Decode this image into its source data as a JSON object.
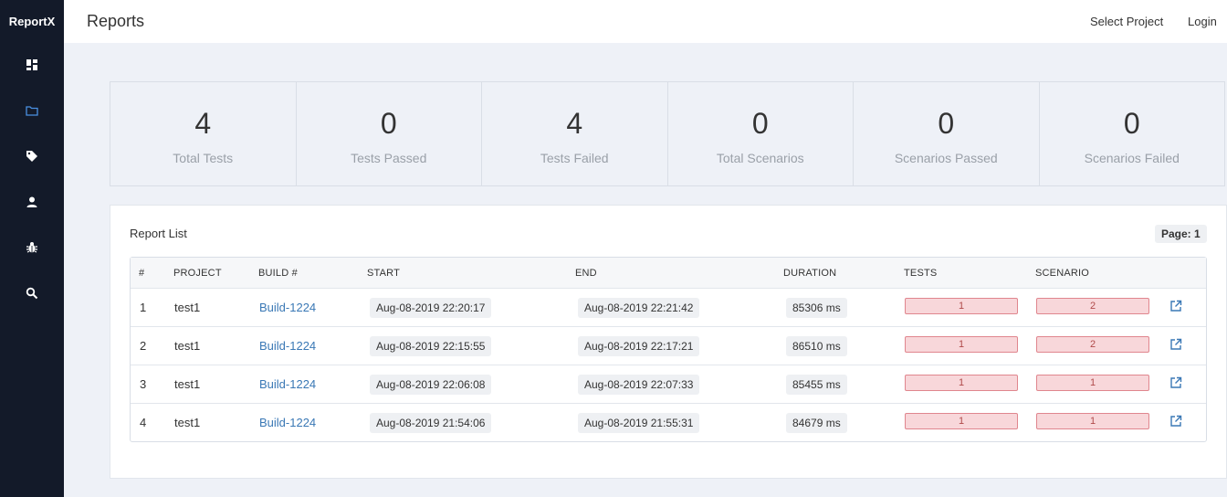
{
  "app": {
    "brand": "ReportX",
    "page_title": "Reports"
  },
  "nav": [
    {
      "icon": "dashboard-icon"
    },
    {
      "icon": "folder-icon"
    },
    {
      "icon": "tag-icon"
    },
    {
      "icon": "user-icon"
    },
    {
      "icon": "bug-icon"
    },
    {
      "icon": "search-icon"
    }
  ],
  "topbar": {
    "select_project": "Select Project",
    "login": "Login"
  },
  "stats": [
    {
      "value": "4",
      "label": "Total Tests"
    },
    {
      "value": "0",
      "label": "Tests Passed"
    },
    {
      "value": "4",
      "label": "Tests Failed"
    },
    {
      "value": "0",
      "label": "Total Scenarios"
    },
    {
      "value": "0",
      "label": "Scenarios Passed"
    },
    {
      "value": "0",
      "label": "Scenarios Failed"
    }
  ],
  "report_list": {
    "title": "Report List",
    "page_label": "Page: 1",
    "columns": [
      "#",
      "PROJECT",
      "BUILD #",
      "START",
      "END",
      "DURATION",
      "TESTS",
      "SCENARIO"
    ],
    "rows": [
      {
        "num": "1",
        "project": "test1",
        "build": "Build-1224",
        "start": "Aug-08-2019 22:20:17",
        "end": "Aug-08-2019 22:21:42",
        "duration": "85306 ms",
        "tests": "1",
        "scenario": "2"
      },
      {
        "num": "2",
        "project": "test1",
        "build": "Build-1224",
        "start": "Aug-08-2019 22:15:55",
        "end": "Aug-08-2019 22:17:21",
        "duration": "86510 ms",
        "tests": "1",
        "scenario": "2"
      },
      {
        "num": "3",
        "project": "test1",
        "build": "Build-1224",
        "start": "Aug-08-2019 22:06:08",
        "end": "Aug-08-2019 22:07:33",
        "duration": "85455 ms",
        "tests": "1",
        "scenario": "1"
      },
      {
        "num": "4",
        "project": "test1",
        "build": "Build-1224",
        "start": "Aug-08-2019 21:54:06",
        "end": "Aug-08-2019 21:55:31",
        "duration": "84679 ms",
        "tests": "1",
        "scenario": "1"
      }
    ]
  },
  "colors": {
    "sidebar": "#131a29",
    "active_nav": "#4a90e2",
    "link": "#3a78b5",
    "failed_fill": "#f8d7da",
    "failed_border": "#e0868e"
  }
}
